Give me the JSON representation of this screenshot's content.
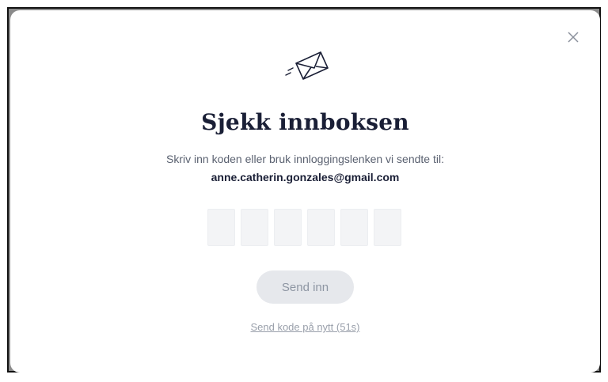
{
  "modal": {
    "close_icon": "close-icon",
    "envelope_icon": "envelope-icon",
    "title": "Sjekk innboksen",
    "subtitle": "Skriv inn koden eller bruk innloggingslenken vi sendte til:",
    "email": "anne.catherin.gonzales@gmail.com",
    "code_inputs": [
      "",
      "",
      "",
      "",
      "",
      ""
    ],
    "submit_label": "Send inn",
    "resend_label": "Send kode på nytt (51s)"
  },
  "colors": {
    "title": "#1a1f36",
    "subtitle": "#5a6170",
    "code_box_bg": "#f3f4f6",
    "button_bg": "#e6e8ec",
    "button_text": "#8e96a3",
    "link": "#9aa0ab"
  }
}
